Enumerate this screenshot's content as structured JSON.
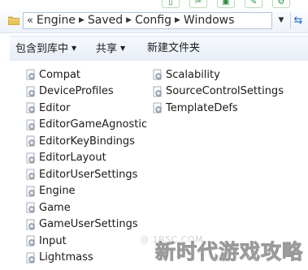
{
  "top_icons": [
    {
      "name": "copy-icon",
      "glyph": "▯"
    },
    {
      "name": "cut-icon",
      "glyph": "✂"
    },
    {
      "name": "save-icon",
      "glyph": "▣"
    },
    {
      "name": "edit-icon",
      "glyph": "✎"
    },
    {
      "name": "settings-icon",
      "glyph": "⚙"
    }
  ],
  "address": {
    "overflow": "«",
    "crumbs": [
      "Engine",
      "Saved",
      "Config",
      "Windows"
    ],
    "refresh_glyph": "⇆"
  },
  "toolbar": {
    "include_in_library": "包含到库中",
    "share": "共享",
    "new_folder": "新建文件夹"
  },
  "files": {
    "col1": [
      "Compat",
      "DeviceProfiles",
      "Editor",
      "EditorGameAgnostic",
      "EditorKeyBindings",
      "EditorLayout",
      "EditorUserSettings",
      "Engine",
      "Game",
      "GameUserSettings",
      "Input",
      "Lightmass"
    ],
    "col2": [
      "Scalability",
      "SourceControlSettings",
      "TemplateDefs"
    ]
  },
  "watermark": {
    "small": "@ 1B5C.COM",
    "big": "新时代游戏攻略"
  },
  "colors": {
    "accent_green": "#2f8f43",
    "toolbar_bg": "#eef3fa",
    "address_border": "#b4c3d9"
  }
}
